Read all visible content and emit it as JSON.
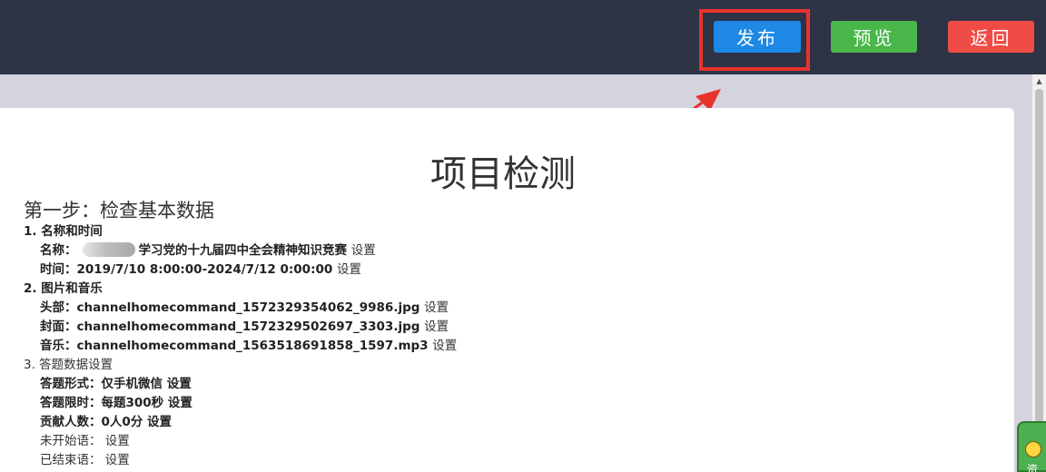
{
  "toolbar": {
    "publish_label": "发布",
    "preview_label": "预览",
    "back_label": "返回"
  },
  "colors": {
    "publish": "#1e88e5",
    "preview": "#49b74a",
    "back": "#ef4c45",
    "highlight": "#e8332c",
    "topbar": "#2e3346"
  },
  "page": {
    "title": "项目检测",
    "step1_title": "第一步：检查基本数据"
  },
  "sections": {
    "name_time": {
      "heading": "1. 名称和时间",
      "name_label": "名称：",
      "name_value": "学习党的十九届四中全会精神知识竞赛",
      "time_label": "时间：",
      "time_value": "2019/7/10 8:00:00-2024/7/12 0:00:00"
    },
    "media": {
      "heading": "2. 图片和音乐",
      "header_label": "头部：",
      "header_value": "channelhomecommand_1572329354062_9986.jpg",
      "cover_label": "封面：",
      "cover_value": "channelhomecommand_1572329502697_3303.jpg",
      "music_label": "音乐：",
      "music_value": "channelhomecommand_1563518691858_1597.mp3"
    },
    "answer": {
      "heading": "3. 答题数据设置",
      "form_label": "答题形式：",
      "form_value": "仅手机微信",
      "limit_label": "答题限时：",
      "limit_value": "每题300秒",
      "contrib_label": "贡献人数：",
      "contrib_value": "0人0分",
      "not_started_label": "未开始语：",
      "ended_label": "已结束语："
    }
  },
  "setting_label": "设置",
  "float_widget": {
    "text": "资",
    "icon": "smiley-icon"
  }
}
